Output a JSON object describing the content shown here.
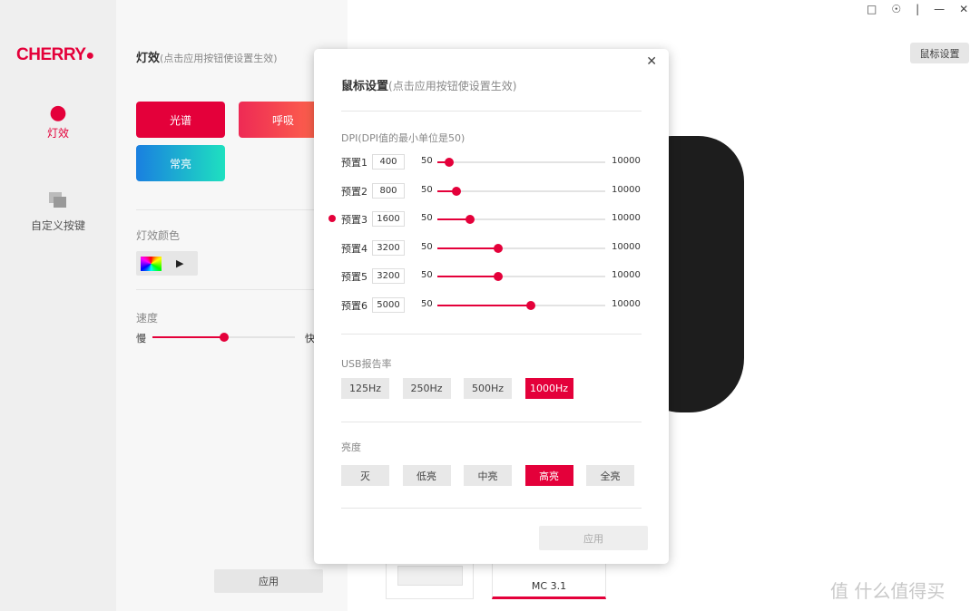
{
  "brand": {
    "logo": "CHERRY",
    "accent": "#e4003a"
  },
  "window_controls": [
    "feedback-icon",
    "settings-icon",
    "minimize-icon",
    "close-icon"
  ],
  "sidebar": {
    "items": [
      {
        "label": "灯效",
        "icon": "bulb-icon",
        "active": true
      },
      {
        "label": "自定义按键",
        "icon": "keys-icon",
        "active": false
      }
    ]
  },
  "panel": {
    "title": "灯效",
    "hint": "(点击应用按钮使设置生效)",
    "effects": [
      "光谱",
      "呼吸",
      "常亮"
    ],
    "color_label": "灯效颜色",
    "speed_label": "速度",
    "speed_slow": "慢",
    "speed_fast": "快",
    "speed_value": 0.5,
    "apply": "应用"
  },
  "header": {
    "mouse_settings": "鼠标设置"
  },
  "devices": [
    {
      "name": ""
    },
    {
      "name": "MC 3.1",
      "active": true
    }
  ],
  "watermark": "值 什么值得买",
  "dialog": {
    "title": "鼠标设置",
    "hint": "(点击应用按钮使设置生效)",
    "dpi_label": "DPI(DPI值的最小单位是50)",
    "dpi_min": "50",
    "dpi_max": "10000",
    "active_preset": 2,
    "presets": [
      {
        "name": "预置1",
        "value": "400"
      },
      {
        "name": "预置2",
        "value": "800"
      },
      {
        "name": "预置3",
        "value": "1600"
      },
      {
        "name": "预置4",
        "value": "3200"
      },
      {
        "name": "预置5",
        "value": "3200"
      },
      {
        "name": "预置6",
        "value": "5000"
      }
    ],
    "usb_label": "USB报告率",
    "usb_rates": [
      "125Hz",
      "250Hz",
      "500Hz",
      "1000Hz"
    ],
    "usb_selected": 3,
    "brightness_label": "亮度",
    "brightness": [
      "灭",
      "低亮",
      "中亮",
      "高亮",
      "全亮"
    ],
    "brightness_selected": 3,
    "apply": "应用"
  }
}
